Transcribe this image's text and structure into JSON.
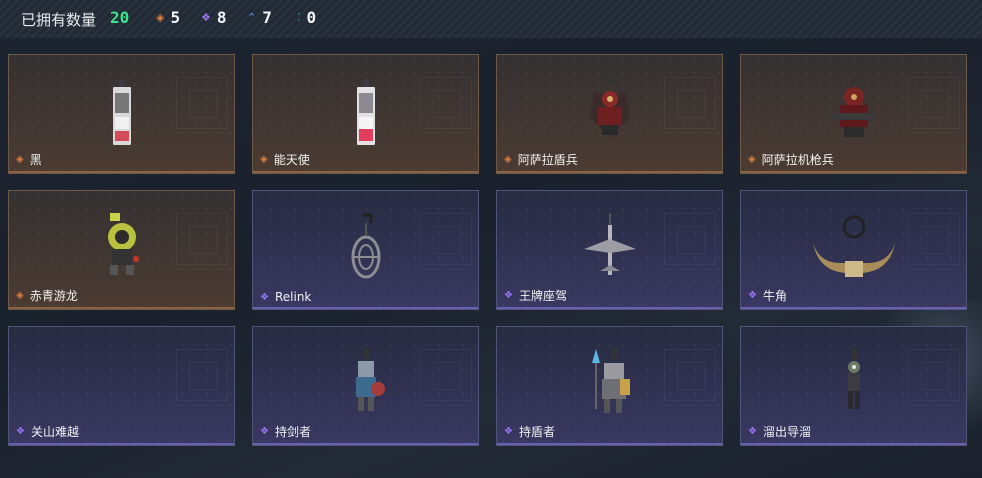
{
  "header": {
    "title": "已拥有数量",
    "total": "20",
    "stats": [
      {
        "icon": "orange-diamond-icon",
        "color": "#e08240",
        "value": "5"
      },
      {
        "icon": "purple-diamond-icon",
        "color": "#9a78f0",
        "value": "8"
      },
      {
        "icon": "blue-chevron-icon",
        "color": "#5a9ee8",
        "value": "7"
      },
      {
        "icon": "teal-dots-icon",
        "color": "#37c0b0",
        "value": "0"
      }
    ]
  },
  "items": [
    {
      "name": "黑",
      "rarity": "orange"
    },
    {
      "name": "能天使",
      "rarity": "orange"
    },
    {
      "name": "阿萨拉盾兵",
      "rarity": "orange"
    },
    {
      "name": "阿萨拉机枪兵",
      "rarity": "orange"
    },
    {
      "name": "赤青游龙",
      "rarity": "orange"
    },
    {
      "name": "Relink",
      "rarity": "purple"
    },
    {
      "name": "王牌座驾",
      "rarity": "purple"
    },
    {
      "name": "牛角",
      "rarity": "purple"
    },
    {
      "name": "关山难越",
      "rarity": "purple"
    },
    {
      "name": "持剑者",
      "rarity": "purple"
    },
    {
      "name": "持盾者",
      "rarity": "purple"
    },
    {
      "name": "溜出导溜",
      "rarity": "purple"
    }
  ]
}
